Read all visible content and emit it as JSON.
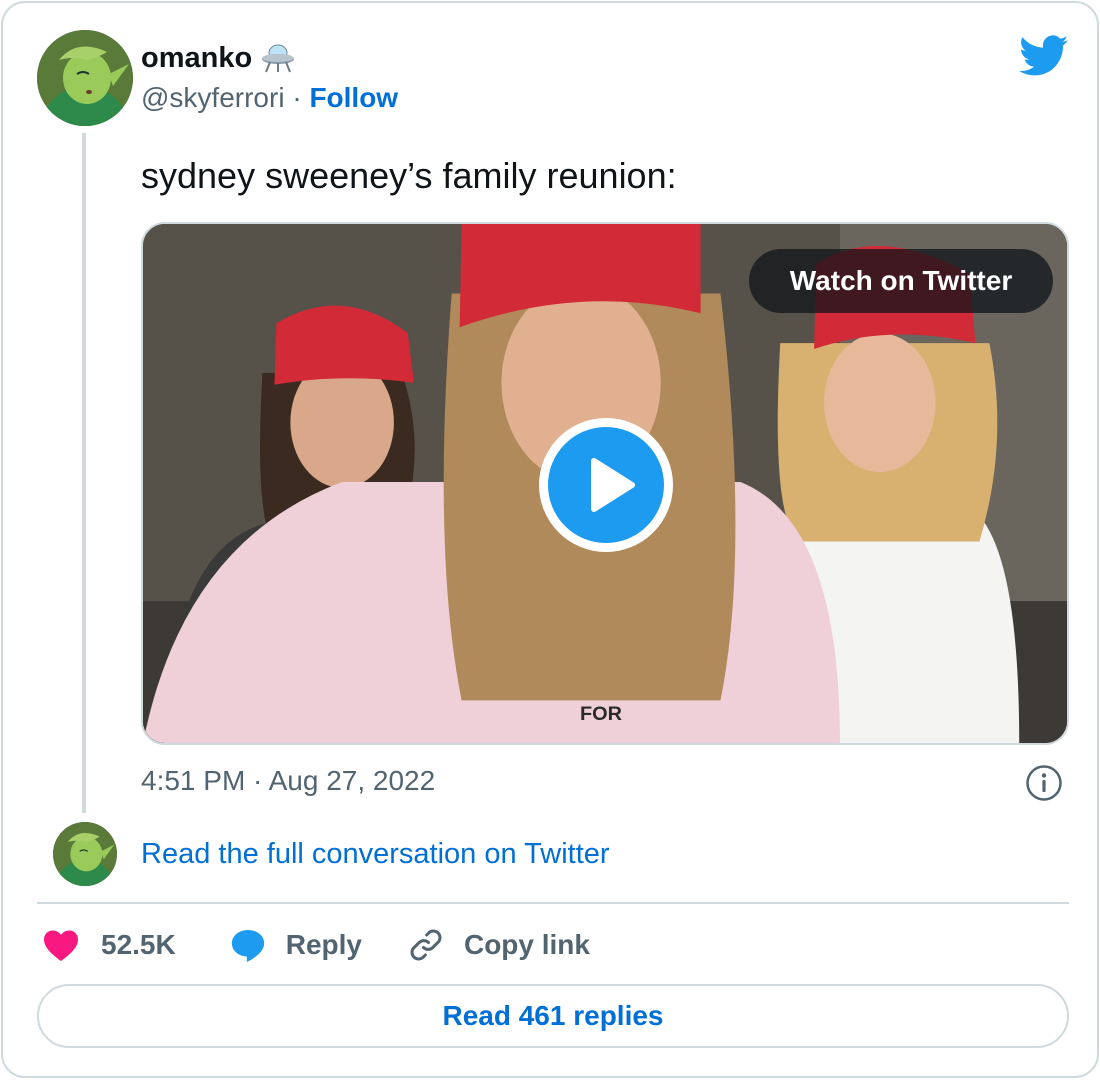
{
  "author": {
    "display_name": "omanko",
    "name_emoji": "ufo-icon",
    "handle": "@skyferrori",
    "separator": " · ",
    "follow_label": "Follow"
  },
  "tweet": {
    "text": "sydney sweeney’s family reunion:",
    "timestamp": "4:51 PM · Aug 27, 2022"
  },
  "media": {
    "type": "video",
    "watch_label": "Watch on Twitter"
  },
  "conversation": {
    "read_full_label": "Read the full conversation on Twitter"
  },
  "actions": {
    "likes_count": "52.5K",
    "reply_label": "Reply",
    "copy_link_label": "Copy link"
  },
  "footer": {
    "read_replies_label": "Read 461 replies"
  },
  "colors": {
    "brand_blue": "#1d9bf0",
    "link_blue": "#006fd6",
    "like_pink": "#f91880",
    "muted_gray": "#536471",
    "border_gray": "#cfd9de"
  }
}
